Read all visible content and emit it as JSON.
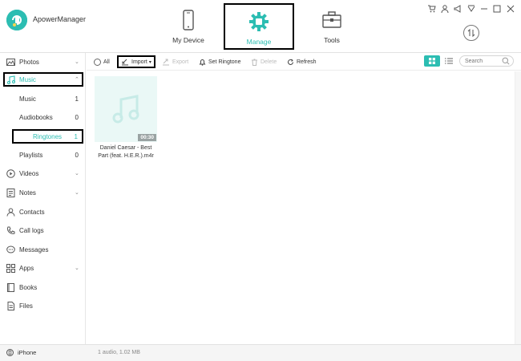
{
  "app": {
    "name": "ApowerManager"
  },
  "nav": {
    "tabs": [
      {
        "label": "My Device",
        "icon": "phone-icon"
      },
      {
        "label": "Manage",
        "icon": "gear-icon",
        "active": true
      },
      {
        "label": "Tools",
        "icon": "toolbox-icon"
      }
    ]
  },
  "window_controls": [
    "cart-icon",
    "user-icon",
    "megaphone-icon",
    "menu-icon",
    "minimize-icon",
    "maximize-icon",
    "close-icon"
  ],
  "sidebar": {
    "items": [
      {
        "label": "Photos",
        "icon": "photo-icon",
        "expandable": true
      },
      {
        "label": "Music",
        "icon": "music-note-icon",
        "expanded": true,
        "selected": true
      },
      {
        "label": "Music",
        "count": "1",
        "sub": true
      },
      {
        "label": "Audiobooks",
        "count": "0",
        "sub": true
      },
      {
        "label": "Ringtones",
        "count": "1",
        "sub": true,
        "selected": true
      },
      {
        "label": "Playlists",
        "count": "0",
        "sub": true
      },
      {
        "label": "Videos",
        "icon": "video-icon",
        "expandable": true
      },
      {
        "label": "Notes",
        "icon": "notes-icon",
        "expandable": true
      },
      {
        "label": "Contacts",
        "icon": "contact-icon"
      },
      {
        "label": "Call logs",
        "icon": "phone-call-icon"
      },
      {
        "label": "Messages",
        "icon": "message-icon"
      },
      {
        "label": "Apps",
        "icon": "apps-icon",
        "expandable": true
      },
      {
        "label": "Books",
        "icon": "book-icon"
      },
      {
        "label": "Files",
        "icon": "file-icon"
      }
    ]
  },
  "toolbar": {
    "all": "All",
    "import": "Import",
    "export": "Export",
    "set_ringtone": "Set Ringtone",
    "delete": "Delete",
    "refresh": "Refresh",
    "search_placeholder": "Search"
  },
  "files": [
    {
      "title": "Daniel Caesar - Best Part (feat. H.E.R.).m4r",
      "duration": "00:30"
    }
  ],
  "status": {
    "device": "iPhone",
    "info": "1 audio, 1.02 MB"
  },
  "colors": {
    "accent": "#2cbdb2",
    "thumb_bg": "#eaf8f6"
  }
}
